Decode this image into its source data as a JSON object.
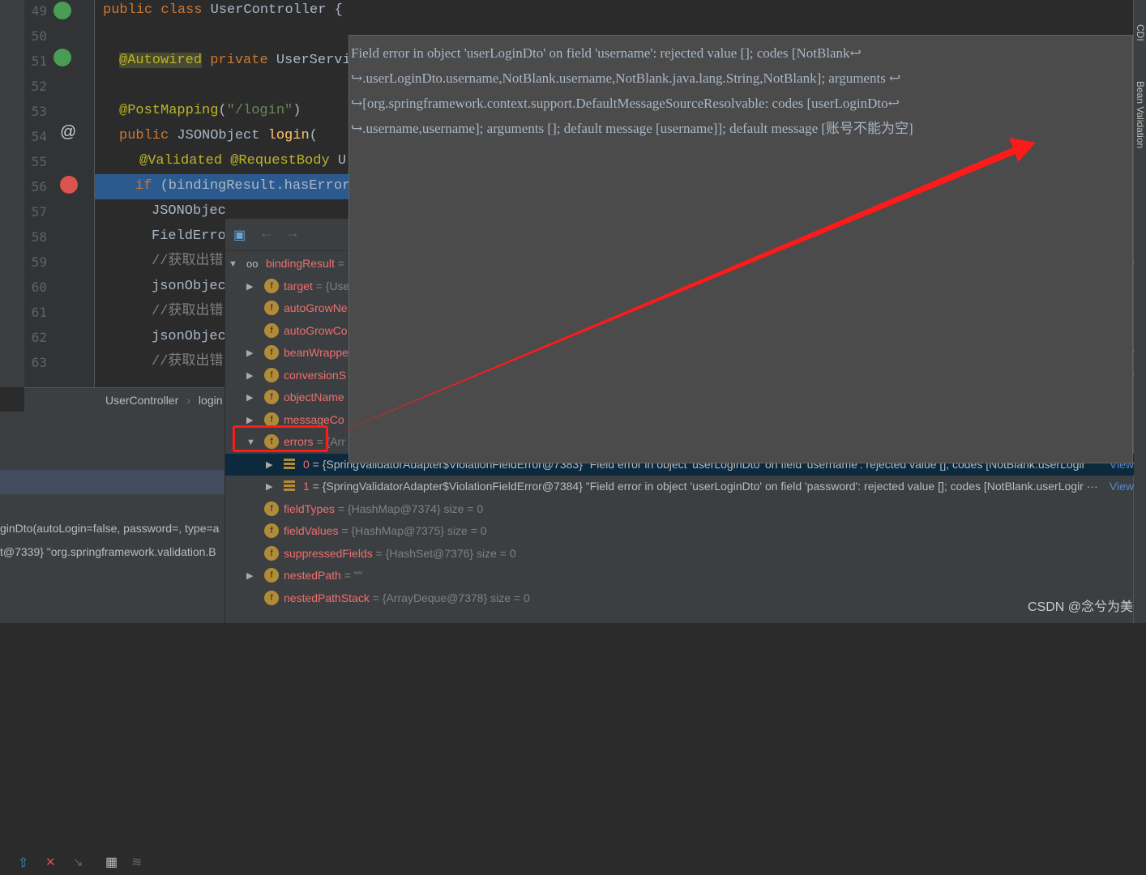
{
  "editor": {
    "lines": [
      {
        "n": "49",
        "t": "public class UserController {"
      },
      {
        "n": "50",
        "t": ""
      },
      {
        "n": "51",
        "t": "@Autowired private UserServic"
      },
      {
        "n": "52",
        "t": ""
      },
      {
        "n": "53",
        "t": "@PostMapping(\"/login\")"
      },
      {
        "n": "54",
        "t": "public JSONObject login("
      },
      {
        "n": "55",
        "t": "@Validated @RequestBody U"
      },
      {
        "n": "56",
        "t": "if (bindingResult.hasError"
      },
      {
        "n": "57",
        "t": "JSONObjec"
      },
      {
        "n": "58",
        "t": "FieldErro"
      },
      {
        "n": "59",
        "t": "//获取出错"
      },
      {
        "n": "60",
        "t": "jsonObjec"
      },
      {
        "n": "61",
        "t": "//获取出错"
      },
      {
        "n": "62",
        "t": "jsonObjec"
      },
      {
        "n": "63",
        "t": "//获取出错"
      }
    ],
    "breadcrumb": [
      "UserController",
      "login"
    ]
  },
  "right_toolbar": [
    "CDI",
    "Bean Validation"
  ],
  "frames_panel": {
    "lines": [
      "ginDto(autoLogin=false, password=, type=a",
      "t@7339} \"org.springframework.validation.B"
    ]
  },
  "variables": {
    "rows": [
      {
        "name": "bindingResult",
        "val": " = ",
        "icon": "watch-icon",
        "expand": "open",
        "view": "View"
      },
      {
        "name": "target",
        "val": " = {Use",
        "icon": "field-icon",
        "expand": "closed"
      },
      {
        "name": "autoGrowNe",
        "val": "",
        "icon": "field-icon",
        "expand": "none"
      },
      {
        "name": "autoGrowCo",
        "val": "",
        "icon": "field-icon",
        "expand": "none"
      },
      {
        "name": "beanWrappe",
        "val": "",
        "icon": "field-icon",
        "expand": "closed",
        "view": "View"
      },
      {
        "name": "conversionS",
        "val": "",
        "icon": "field-icon",
        "expand": "closed",
        "view": "View"
      },
      {
        "name": "objectName",
        "val": "",
        "icon": "field-icon",
        "expand": "closed"
      },
      {
        "name": "messageCo",
        "val": "",
        "icon": "field-icon",
        "expand": "closed"
      },
      {
        "name": "errors",
        "val": " = {Arr",
        "icon": "field-icon",
        "expand": "open"
      },
      {
        "name": "0",
        "val": " = {SpringValidatorAdapter$ViolationFieldError@7383} \"Field error in object 'userLoginDto' on field 'username': rejected value []; codes [NotBlank.userLogir",
        "icon": "array-icon",
        "expand": "closed",
        "child": true,
        "view": "View"
      },
      {
        "name": "1",
        "val": " = {SpringValidatorAdapter$ViolationFieldError@7384} \"Field error in object 'userLoginDto' on field 'password': rejected value []; codes [NotBlank.userLogir ···",
        "icon": "array-icon",
        "expand": "closed",
        "child": true,
        "view": "View"
      },
      {
        "name": "fieldTypes",
        "val": " = {HashMap@7374}  size = 0",
        "icon": "field-icon",
        "expand": "none"
      },
      {
        "name": "fieldValues",
        "val": " = {HashMap@7375}  size = 0",
        "icon": "field-icon",
        "expand": "none"
      },
      {
        "name": "suppressedFields",
        "val": " = {HashSet@7376}  size = 0",
        "icon": "field-icon",
        "expand": "none"
      },
      {
        "name": "nestedPath",
        "val": " = \"\"",
        "icon": "field-icon",
        "expand": "closed"
      },
      {
        "name": "nestedPathStack",
        "val": " = {ArrayDeque@7378}  size = 0",
        "icon": "field-icon",
        "expand": "none"
      }
    ]
  },
  "tooltip": {
    "lines": [
      "Field error in object 'userLoginDto' on field 'username': rejected value []; codes [NotBlank↩",
      "↪.userLoginDto.username,NotBlank.username,NotBlank.java.lang.String,NotBlank]; arguments ↩",
      "↪[org.springframework.context.support.DefaultMessageSourceResolvable: codes [userLoginDto↩",
      "↪.username,username]; arguments []; default message [username]]; default message [账号不能为空]"
    ]
  },
  "annotation": {
    "color": "#ff1a1a"
  },
  "watermark": "CSDN @念兮为美"
}
